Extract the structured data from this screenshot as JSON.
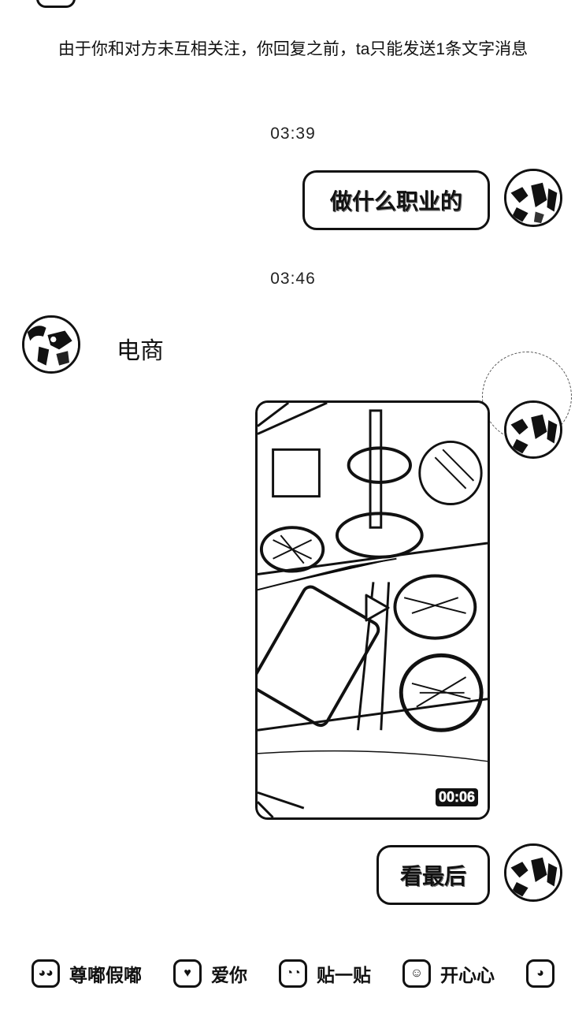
{
  "chat": {
    "notice": "由于你和对方未互相关注，你回复之前，ta只能发送1条文字消息",
    "messages": [
      {
        "type": "time",
        "text": "03:39"
      },
      {
        "type": "outgoing_text",
        "text": "做什么职业的"
      },
      {
        "type": "time",
        "text": "03:46"
      },
      {
        "type": "incoming_text",
        "text": "电商"
      },
      {
        "type": "outgoing_video",
        "duration": "00:06"
      },
      {
        "type": "outgoing_text",
        "text": "看最后"
      }
    ]
  },
  "stickers": [
    {
      "label": "尊嘟假嘟",
      "icon": "panda-face-icon"
    },
    {
      "label": "爱你",
      "icon": "panda-love-icon"
    },
    {
      "label": "贴一贴",
      "icon": "panda-hug-icon"
    },
    {
      "label": "开心心",
      "icon": "panda-happy-icon"
    },
    {
      "label": "",
      "icon": "panda-more-icon"
    }
  ]
}
